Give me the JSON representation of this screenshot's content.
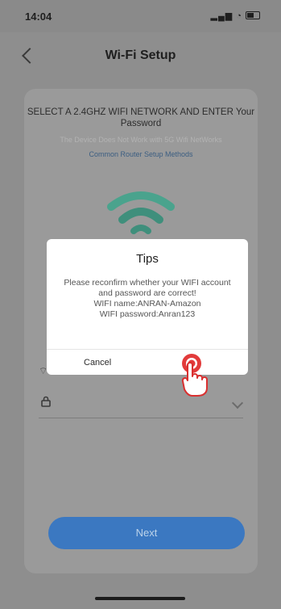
{
  "status_bar": {
    "time": "14:04"
  },
  "nav": {
    "title": "Wi-Fi Setup",
    "back_icon": "chevron-left-icon"
  },
  "setup": {
    "heading": "SELECT A 2.4GHZ WIFI NETWORK AND ENTER Your Password",
    "warning": "The Device Does Not Work with 5G Wifi NetWorks",
    "router_link": "Common Router Setup Methods",
    "next_label": "Next"
  },
  "dialog": {
    "title": "Tips",
    "message": "Please reconfirm whether your WIFI account and password are correct!",
    "wifi_name": "WIFI name:ANRAN-Amazon",
    "wifi_password": "WIFI password:Anran123",
    "cancel_label": "Cancel"
  },
  "colors": {
    "next_button": "#3b78c1",
    "wifi_icon": "#4aa38d",
    "confirm_accent": "#e23b3b"
  },
  "icons": {
    "wifi": "wifi-icon",
    "lock": "lock-icon",
    "pointer_hand": "hand-pointer-icon"
  }
}
